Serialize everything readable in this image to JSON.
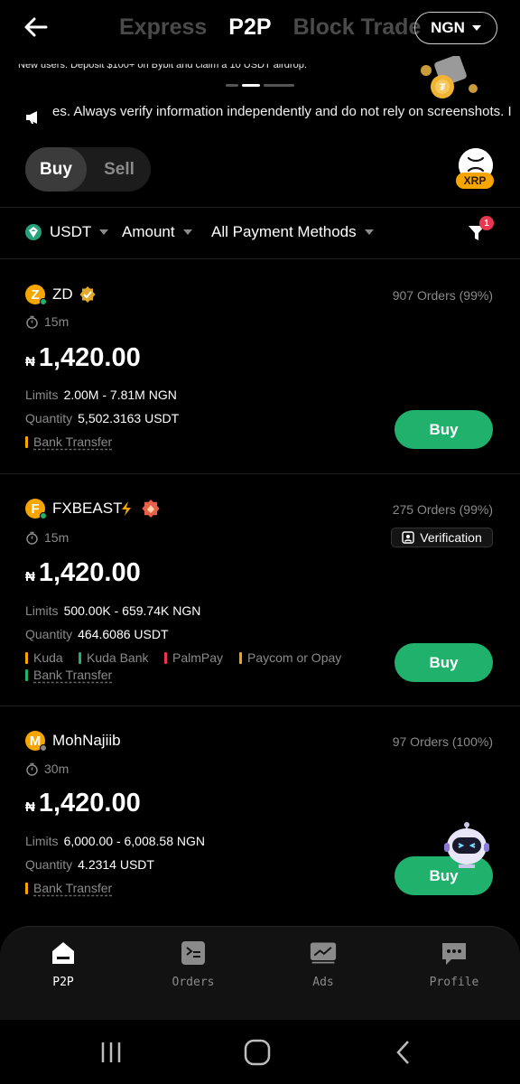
{
  "header": {
    "tabs": [
      "Express",
      "P2P",
      "Block Trade"
    ],
    "active_tab": "P2P",
    "currency": "NGN"
  },
  "banner": {
    "text": "New users: Deposit $100+ on Bybit and claim a 10 USDT airdrop."
  },
  "notice": {
    "text": "es. Always verify information independently and do not rely on screenshots. I"
  },
  "trade_toggle": {
    "buy": "Buy",
    "sell": "Sell"
  },
  "coin": {
    "badge": "XRP"
  },
  "filters": {
    "asset": "USDT",
    "amount": "Amount",
    "payment": "All Payment Methods",
    "filter_count": "1"
  },
  "offers": [
    {
      "initial": "Z",
      "name": "ZD",
      "orders": "907 Orders (99%)",
      "time": "15m",
      "currency_symbol": "₦",
      "price": "1,420.00",
      "limits_label": "Limits",
      "limits": "2.00M - 7.81M NGN",
      "quantity_label": "Quantity",
      "quantity": "5,502.3163 USDT",
      "payments": [
        "Bank Transfer"
      ],
      "buy": "Buy"
    },
    {
      "initial": "F",
      "name": "FXBEAST",
      "orders": "275 Orders (99%)",
      "time": "15m",
      "verification": "Verification",
      "currency_symbol": "₦",
      "price": "1,420.00",
      "limits_label": "Limits",
      "limits": "500.00K - 659.74K NGN",
      "quantity_label": "Quantity",
      "quantity": "464.6086 USDT",
      "payments": [
        "Kuda",
        "Kuda Bank",
        "PalmPay",
        "Paycom or Opay",
        "Bank Transfer"
      ],
      "buy": "Buy"
    },
    {
      "initial": "M",
      "name": "MohNajiib",
      "orders": "97 Orders (100%)",
      "time": "30m",
      "currency_symbol": "₦",
      "price": "1,420.00",
      "limits_label": "Limits",
      "limits": "6,000.00 - 6,008.58 NGN",
      "quantity_label": "Quantity",
      "quantity": "4.2314 USDT",
      "payments": [
        "Bank Transfer"
      ],
      "buy": "Buy"
    }
  ],
  "bottom_nav": [
    {
      "label": "P2P",
      "icon": "home-icon"
    },
    {
      "label": "Orders",
      "icon": "orders-icon"
    },
    {
      "label": "Ads",
      "icon": "ads-chart-icon"
    },
    {
      "label": "Profile",
      "icon": "chat-profile-icon"
    }
  ],
  "colors": {
    "accent_green": "#20b26c",
    "brand_orange": "#f7a600",
    "muted": "#8a8a8a",
    "payment_orange": "#f7a600",
    "payment_green": "#20b26c",
    "payment_red": "#e8384f"
  }
}
